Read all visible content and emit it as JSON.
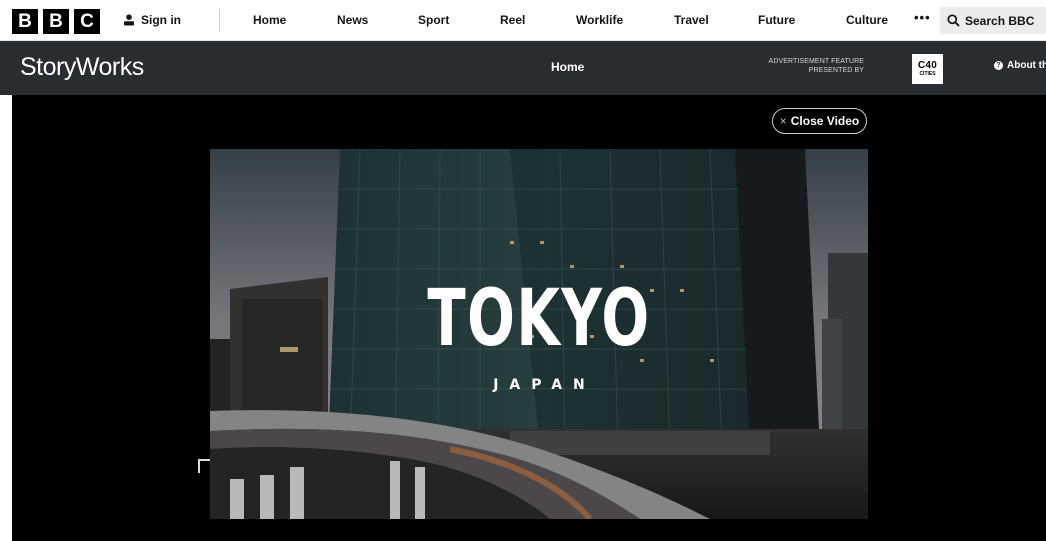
{
  "bbc": {
    "logo_letters": [
      "B",
      "B",
      "C"
    ],
    "signin_label": "Sign in",
    "nav": [
      {
        "label": "Home"
      },
      {
        "label": "News"
      },
      {
        "label": "Sport"
      },
      {
        "label": "Reel"
      },
      {
        "label": "Worklife"
      },
      {
        "label": "Travel"
      },
      {
        "label": "Future"
      },
      {
        "label": "Culture"
      }
    ],
    "more_label": "•••",
    "search_label": "Search BBC"
  },
  "storyworks": {
    "logo": "StoryWorks",
    "home_label": "Home",
    "ad_feature_line1": "ADVERTISEMENT FEATURE",
    "ad_feature_line2": "PRESENTED BY",
    "sponsor_top": "C40",
    "sponsor_bottom": "CITIES",
    "about_label": "About th"
  },
  "video": {
    "close_label": "Close Video",
    "close_icon": "×",
    "title": "TOKYO",
    "subtitle": "JAPAN"
  },
  "colors": {
    "storyworks_bar": "#292d31",
    "stage_bg": "#000000",
    "nav_text": "#141414",
    "search_bg": "#ececec"
  }
}
